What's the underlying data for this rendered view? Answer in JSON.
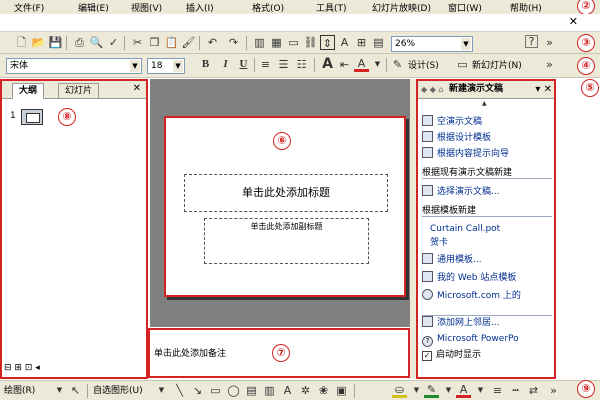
{
  "menubar": {
    "items": [
      "文件(F)",
      "编辑(E)",
      "视图(V)",
      "插入(I)",
      "格式(O)",
      "工具(T)",
      "幻灯片放映(D)",
      "窗口(W)",
      "帮助(H)"
    ]
  },
  "toolbar": {
    "zoom": "26%",
    "help_icon": "?",
    "more": "»"
  },
  "format_toolbar": {
    "font": "宋体",
    "size": "18",
    "bold": "B",
    "italic": "I",
    "underline": "U",
    "design_button": "设计(S)",
    "new_slide_button": "新幻灯片(N)"
  },
  "outline_pane": {
    "tab_outline": "大纲",
    "tab_slides": "幻灯片",
    "slide_number": "1"
  },
  "slide": {
    "title_placeholder": "单击此处添加标题",
    "subtitle_placeholder": "单击此处添加副标题"
  },
  "notes": {
    "placeholder": "单击此处添加备注"
  },
  "task_pane": {
    "title": "新建演示文稿",
    "items": [
      {
        "label": "空演示文稿"
      },
      {
        "label": "根据设计模板"
      },
      {
        "label": "根据内容提示向导"
      }
    ],
    "section_existing": "根据现有演示文稿新建",
    "choose_presentation": "选择演示文稿...",
    "section_template": "根据模板新建",
    "recent_template_1": "Curtain Call.pot",
    "recent_template_2": "贺卡",
    "general_templates": "通用模板...",
    "web_templates": "我的 Web 站点模板",
    "ms_templates": "Microsoft.com 上的",
    "add_network": "添加网上邻居...",
    "ms_help": "Microsoft PowerPo",
    "show_on_startup": "启动时显示"
  },
  "drawbar": {
    "draw_menu": "绘图(R)",
    "autoshapes_menu": "自选图形(U)"
  },
  "callouts": [
    "②",
    "③",
    "④",
    "⑤",
    "⑥",
    "⑦",
    "⑧",
    "⑨"
  ]
}
